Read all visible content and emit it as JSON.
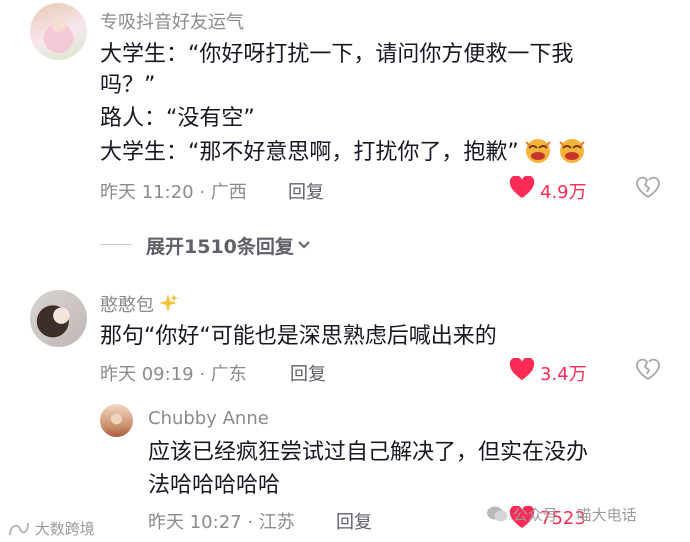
{
  "comment1": {
    "username": "专吸抖音好友运气",
    "lines": [
      "大学生：“你好呀打扰一下，请问你方便救一下我",
      "吗？”",
      "路人：“没有空”",
      "大学生：“那不好意思啊，打扰你了，抱歉”"
    ],
    "time": "昨天 11:20 · 广西",
    "reply_label": "回复",
    "like_count": "4.9万",
    "expand_label": "展开1510条回复"
  },
  "comment2": {
    "username": "憨憨包",
    "text": "那句“你好“可能也是深思熟虑后喊出来的",
    "time": "昨天 09:19 · 广东",
    "reply_label": "回复",
    "like_count": "3.4万"
  },
  "reply1": {
    "username": "Chubby Anne",
    "lines": [
      "应该已经疯狂尝试过自己解决了，但实在没办",
      "法哈哈哈哈哈"
    ],
    "time": "昨天 10:27 · 江苏",
    "reply_label": "回复",
    "like_count": "7523"
  },
  "watermarks": {
    "left": "大数跨境",
    "right_a": "公众号",
    "right_b": "喵大电话"
  },
  "colors": {
    "like_red": "#fe2c55",
    "meta_gray": "#8a8b91"
  }
}
